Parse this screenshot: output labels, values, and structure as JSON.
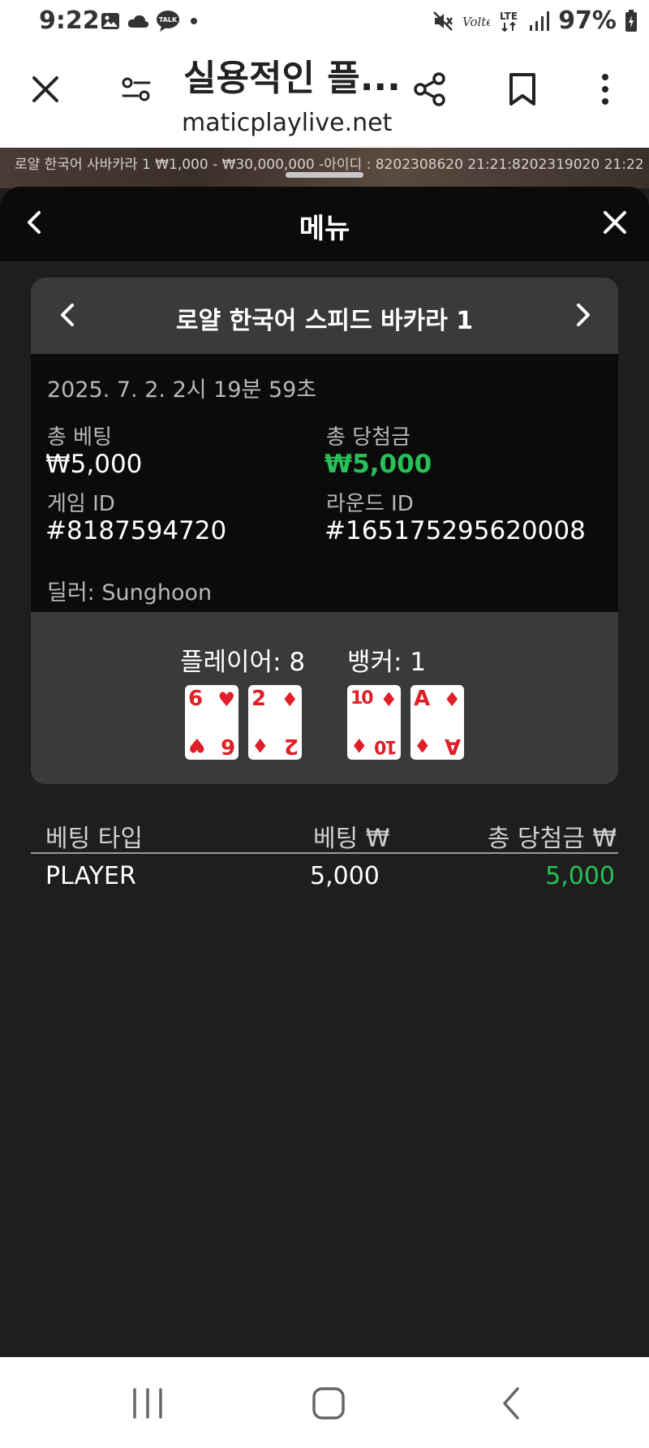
{
  "status_bar": {
    "time": "9:22",
    "battery": "97%",
    "icons": [
      "gallery-icon",
      "cloud-icon",
      "talk-icon",
      "dot-icon",
      "mute-icon",
      "volte-icon",
      "lte-icon",
      "signal-icon",
      "battery-icon"
    ]
  },
  "browser": {
    "title": "실용적인 플...",
    "url": "maticplaylive.net"
  },
  "ticker": {
    "text": "로얄 한국어 사바카라 1 ₩1,000 - ₩30,000,000 -아이디 : 8202308620 21:21:8202319020  21:22"
  },
  "menu": {
    "title": "메뉴"
  },
  "game": {
    "name": "로얄 한국어 스피드 바카라 1",
    "date": "2025. 7. 2. 2시 19분 59초",
    "total_bet_label": "총 베팅",
    "total_bet_value": "₩5,000",
    "total_win_label": "총 당첨금",
    "total_win_value": "₩5,000",
    "game_id_label": "게임 ID",
    "game_id_value": "#8187594720",
    "round_id_label": "라운드 ID",
    "round_id_value": "#165175295620008",
    "dealer": "딜러: Sunghoon",
    "player_label": "플레이어: 8",
    "banker_label": "뱅커: 1",
    "player_cards": [
      {
        "rank": "6",
        "suit": "♥"
      },
      {
        "rank": "2",
        "suit": "♦"
      }
    ],
    "banker_cards": [
      {
        "rank": "10",
        "suit": "♦"
      },
      {
        "rank": "A",
        "suit": "♦"
      }
    ]
  },
  "bets": {
    "headers": {
      "type": "베팅 타입",
      "bet": "베팅 ₩",
      "win": "총 당첨금 ₩"
    },
    "rows": [
      {
        "type": "PLAYER",
        "bet": "5,000",
        "win": "5,000"
      }
    ]
  },
  "colors": {
    "win_green": "#27c15a",
    "card_red": "#e01e28",
    "sheet_bg": "#1e1e1e",
    "panel_bg": "#0b0b0b",
    "card_bg": "#3a3a3a"
  }
}
